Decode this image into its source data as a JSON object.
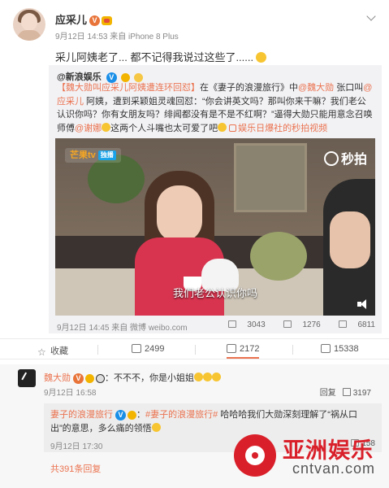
{
  "post": {
    "author": "应采儿",
    "v_badge": "V",
    "meta": "9月12日 14:53 来自 iPhone 8 Plus",
    "text": "采儿阿姨老了... 都不记得我说过这些了......"
  },
  "repost": {
    "author": "@新浪娱乐",
    "v_badge": "V",
    "tag": "【魏大勋叫应采儿阿姨遭连环回怼】",
    "text_1": "在《妻子的浪漫旅行》中",
    "mention_1": "@魏大勋",
    "text_2": " 张口叫",
    "mention_2": "@应采儿",
    "text_3": " 阿姨，遭到采颖姐灵魂回怼：“你会讲英文吗？那叫你来干嘛？我们老公认识你吗？你有女朋友吗？绯闻都没有是不是不红啊？”逼得大勋只能用意念召唤师傅",
    "mention_3": "@谢娜",
    "text_4": "这两个人斗嘴也太可爱了吧",
    "link": "娱乐日爆社的秒拍视频",
    "video": {
      "logo_mango": "芒果tv",
      "logo_mango_sub": "独播",
      "logo_miaopai": "秒拍",
      "subtitle": "我们老公认识你吗"
    },
    "footer_meta": "9月12日 14:45 来自 微博 weibo.com",
    "stats": {
      "reposts": "3043",
      "comments": "1276",
      "likes": "6811"
    }
  },
  "actions": {
    "favorite": "收藏",
    "repost": "2499",
    "comment": "2172",
    "like": "15338"
  },
  "comment": {
    "name": "魏大勋",
    "v_badge": "V",
    "text": "：不不不，你是小姐姐",
    "meta": "9月12日 16:58",
    "reply_label": "回复",
    "likes": "3197"
  },
  "reply": {
    "name": "妻子的浪漫旅行",
    "tag": "#妻子的浪漫旅行#",
    "text": " 哈哈哈我们大勋深刻理解了“祸从口出”的意思，多么痛的领悟",
    "meta": "9月12日 17:30",
    "likes": "158"
  },
  "more_replies": "共391条回复",
  "watermark": {
    "cn": "亚洲娱乐",
    "en": "cntvan.com"
  },
  "colors": {
    "accent": "#eb7350",
    "repost_bg": "#f2f2f5",
    "comments_bg": "#f7f7f7",
    "watermark_red": "#d9202a"
  }
}
